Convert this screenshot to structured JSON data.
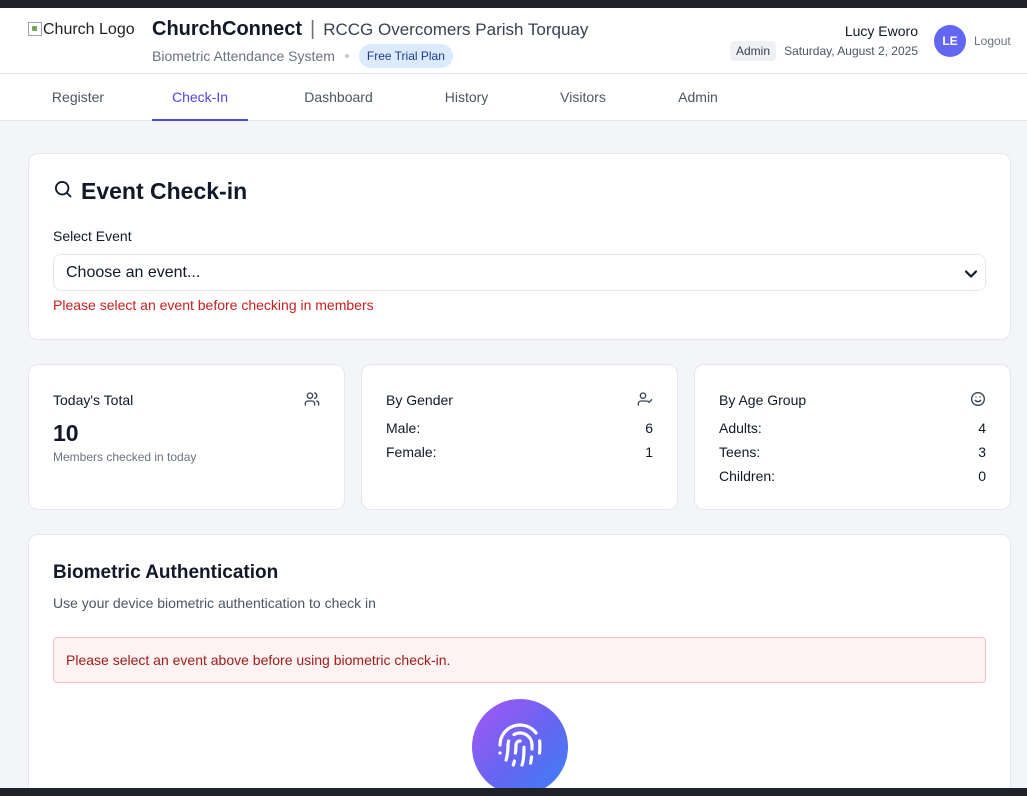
{
  "header": {
    "logo_alt": "Church Logo",
    "app_name": "ChurchConnect",
    "separator": "|",
    "parish": "RCCG Overcomers Parish Torquay",
    "system_name": "Biometric Attendance System",
    "plan_badge": "Free Trial Plan",
    "user_name": "Lucy Eworo",
    "role": "Admin",
    "date": "Saturday, August 2, 2025",
    "avatar_initials": "LE",
    "logout_label": "Logout"
  },
  "nav": {
    "tabs": [
      {
        "label": "Register"
      },
      {
        "label": "Check-In"
      },
      {
        "label": "Dashboard"
      },
      {
        "label": "History"
      },
      {
        "label": "Visitors"
      },
      {
        "label": "Admin"
      }
    ],
    "active_tab": "Check-In"
  },
  "checkin": {
    "title": "Event Check-in",
    "select_label": "Select Event",
    "select_value": "Choose an event...",
    "error": "Please select an event before checking in members"
  },
  "stats": {
    "total": {
      "title": "Today's Total",
      "value": "10",
      "caption": "Members checked in today"
    },
    "gender": {
      "title": "By Gender",
      "rows": [
        {
          "label": "Male:",
          "value": "6"
        },
        {
          "label": "Female:",
          "value": "1"
        }
      ]
    },
    "age": {
      "title": "By Age Group",
      "rows": [
        {
          "label": "Adults:",
          "value": "4"
        },
        {
          "label": "Teens:",
          "value": "3"
        },
        {
          "label": "Children:",
          "value": "0"
        }
      ]
    }
  },
  "biometric": {
    "title": "Biometric Authentication",
    "subtitle": "Use your device biometric authentication to check in",
    "alert": "Please select an event above before using biometric check-in."
  },
  "colors": {
    "accent": "#4f46e5",
    "avatar": "#6366f1",
    "error_text": "#c81e1e",
    "alert_bg": "#fef2f2",
    "plan_badge_bg": "#dbeafe"
  },
  "icons": {
    "checkin_title": "search-icon",
    "total": "users-icon",
    "gender": "user-check-icon",
    "age": "smile-icon",
    "select": "chevron-down-icon",
    "biometric": "fingerprint-icon"
  }
}
